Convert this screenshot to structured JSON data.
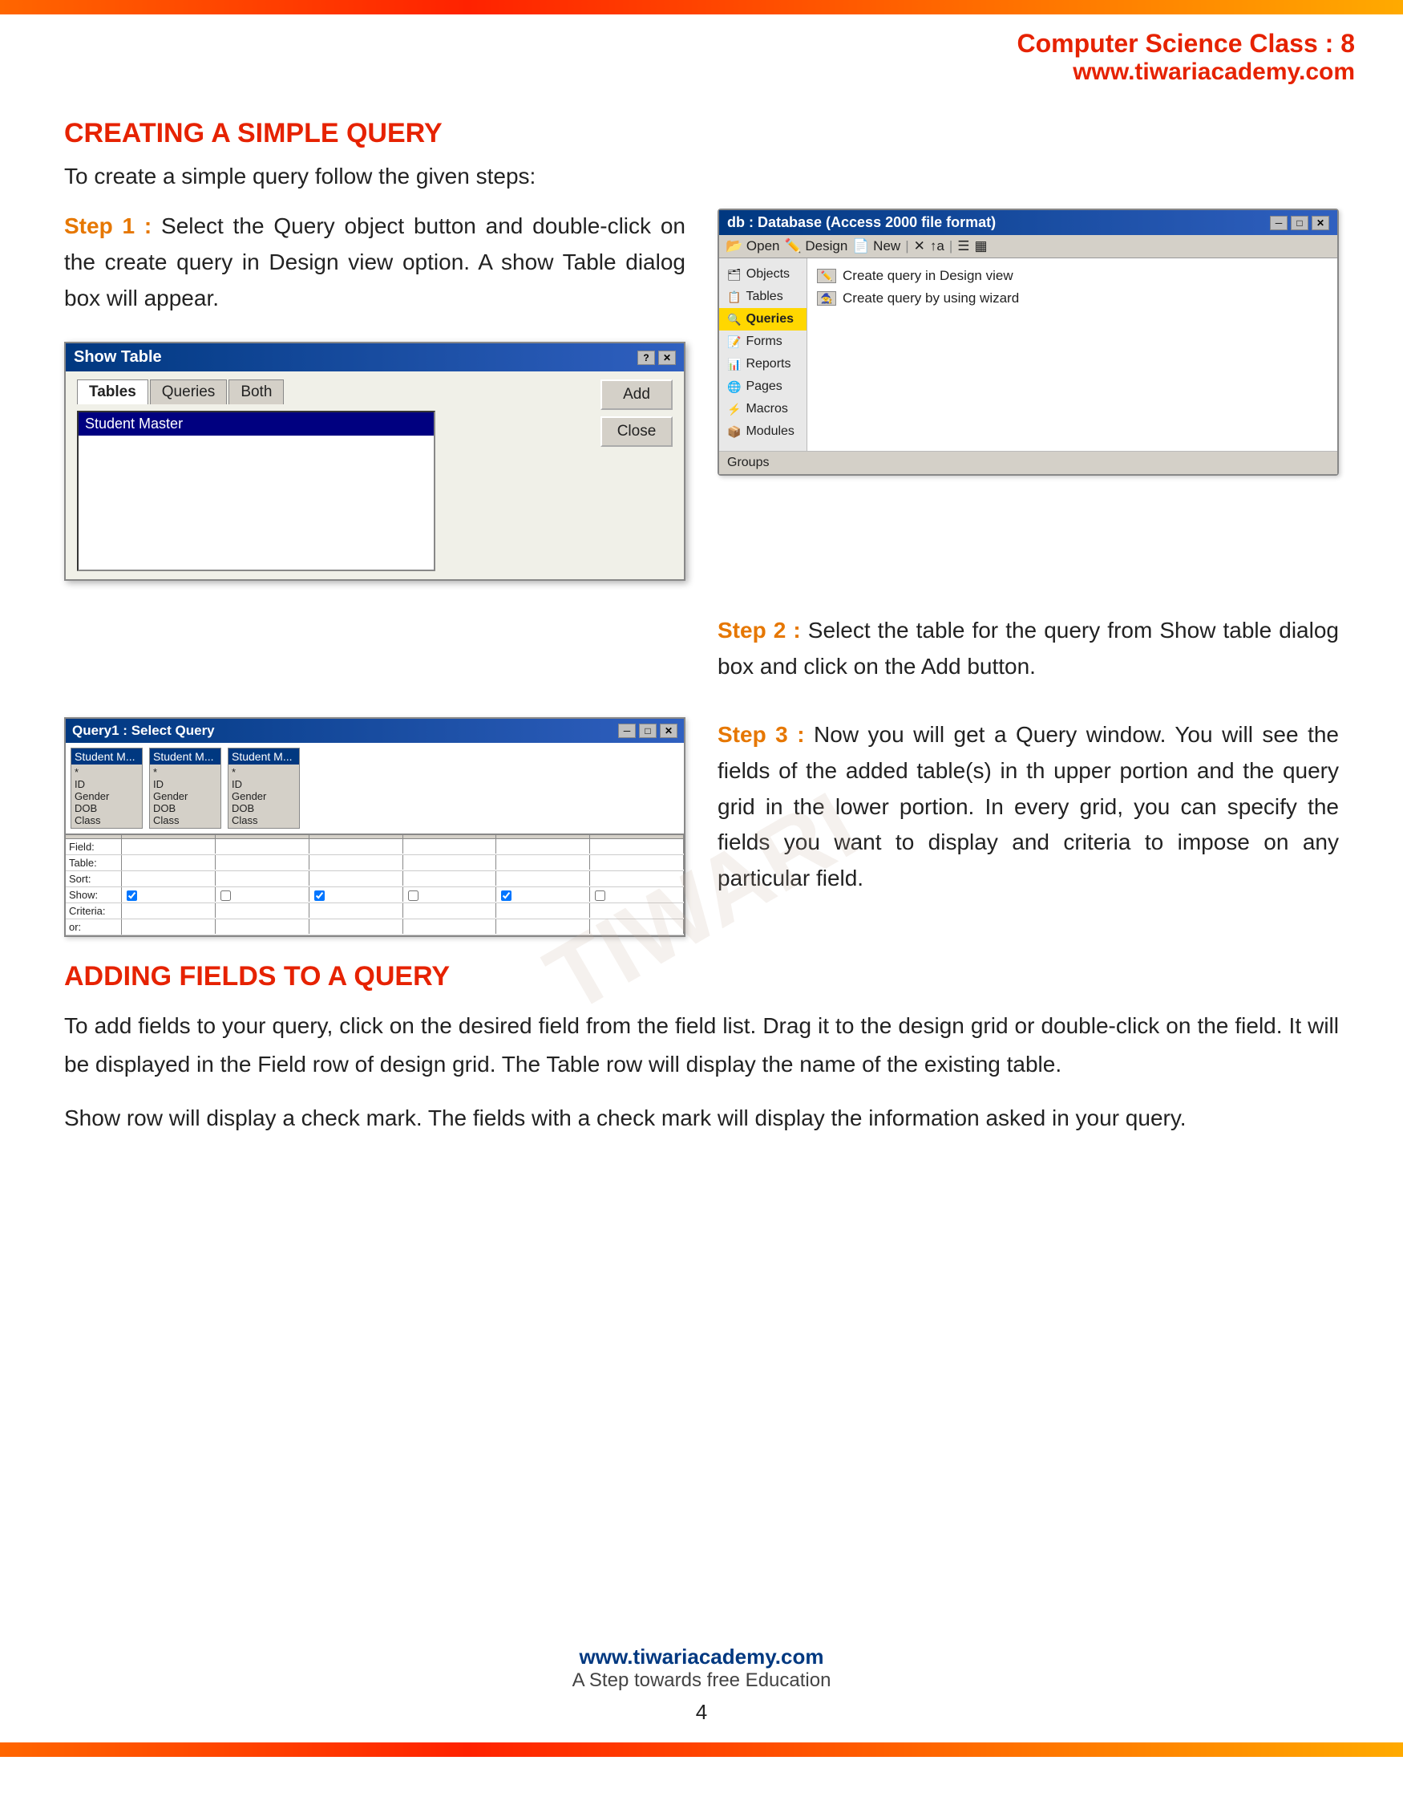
{
  "header": {
    "title": "Computer Science Class : 8",
    "url": "www.tiwariacademy.com"
  },
  "section1": {
    "heading": "CREATING A SIMPLE QUERY",
    "intro": "To create a simple query follow the given steps:"
  },
  "step1": {
    "label": "Step 1 :",
    "text": " Select the Query object button and double-click on the create query in Design view option. A show Table dialog box will appear."
  },
  "step2": {
    "label": "Step 2 :",
    "text": " Select the table for the query from Show table dialog box and click on the Add button."
  },
  "step3": {
    "label": "Step 3 :",
    "text": " Now you will get a Query window. You will see the fields of the added table(s) in th upper portion and the query grid in the lower portion. In every grid, you can specify the fields you want to display and criteria to impose on any particular field."
  },
  "access_window": {
    "title": "db : Database (Access 2000 file format)",
    "toolbar": [
      "Open",
      "Design",
      "New",
      "X",
      "↑a",
      "☰",
      "▦"
    ],
    "sidebar_items": [
      "Objects",
      "Tables",
      "Queries",
      "Forms",
      "Reports",
      "Pages",
      "Macros",
      "Modules"
    ],
    "active_item": "Queries",
    "options": [
      "Create query in Design view",
      "Create query by using wizard"
    ],
    "footer": "Groups"
  },
  "show_table": {
    "title": "Show Table",
    "tabs": [
      "Tables",
      "Queries",
      "Both"
    ],
    "active_tab": "Tables",
    "list_items": [
      "Student Master"
    ],
    "buttons": [
      "Add",
      "Close"
    ]
  },
  "query_window": {
    "title": "Query1 : Select Query",
    "tables": [
      {
        "name": "Student M...",
        "fields": [
          "*",
          "ID",
          "Gender",
          "DOB",
          "Class"
        ]
      },
      {
        "name": "Student M...",
        "fields": [
          "*",
          "ID",
          "Gender",
          "DOB",
          "Class"
        ]
      },
      {
        "name": "Student M...",
        "fields": [
          "*",
          "ID",
          "Gender",
          "DOB",
          "Class"
        ]
      }
    ],
    "grid_rows": [
      "Field:",
      "Table:",
      "Sort:",
      "Show:",
      "Criteria:",
      "or:"
    ]
  },
  "section2": {
    "heading": "ADDING FIELDS TO A QUERY",
    "text1": "To add fields to your query, click on the desired field from the field list. Drag it to the design grid or double-click on the field. It will be displayed in the Field row of design grid. The Table row will display the name of the existing table.",
    "text2": "Show row will display a check mark. The fields with a check mark will display the information asked in your query."
  },
  "footer": {
    "url": "www.tiwariacademy.com",
    "tagline": "A Step towards free Education",
    "page": "4"
  }
}
